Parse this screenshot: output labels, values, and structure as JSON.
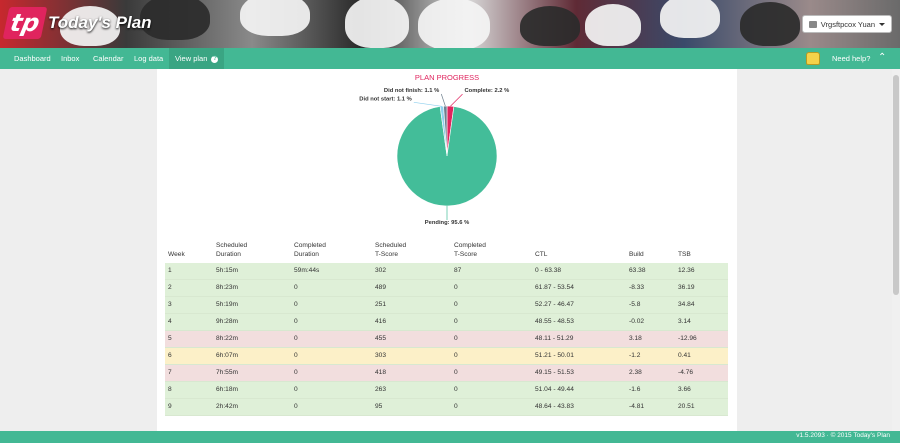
{
  "header": {
    "logo_mark": "tp",
    "logo_text": "Today's Plan",
    "user_name": "Vrgsftpcox Yuan"
  },
  "nav": {
    "items": [
      {
        "label": "Dashboard"
      },
      {
        "label": "Inbox"
      },
      {
        "label": "Calendar"
      },
      {
        "label": "Log data"
      },
      {
        "label": "View plan"
      }
    ],
    "active": "View plan",
    "help_label": "Need help?",
    "view_plan_badge": "?"
  },
  "plan_progress": {
    "title": "PLAN PROGRESS",
    "chart_data": {
      "type": "pie",
      "slices": [
        {
          "label": "Complete",
          "value": 2.2,
          "color": "#e0245e",
          "display": "Complete: 2.2 %"
        },
        {
          "label": "Pending",
          "value": 95.6,
          "color": "#43bd99",
          "display": "Pending: 95.6 %"
        },
        {
          "label": "Did not start",
          "value": 1.1,
          "color": "#8fd0ee",
          "display": "Did not start: 1.1 %"
        },
        {
          "label": "Did not finish",
          "value": 1.1,
          "color": "#6e7f8e",
          "display": "Did not finish: 1.1 %"
        }
      ]
    }
  },
  "table": {
    "headers": [
      {
        "l1": "",
        "l2": "Week"
      },
      {
        "l1": "Scheduled",
        "l2": "Duration"
      },
      {
        "l1": "Completed",
        "l2": "Duration"
      },
      {
        "l1": "Scheduled",
        "l2": "T-Score"
      },
      {
        "l1": "Completed",
        "l2": "T-Score"
      },
      {
        "l1": "",
        "l2": "CTL"
      },
      {
        "l1": "",
        "l2": "Build"
      },
      {
        "l1": "",
        "l2": "TSB"
      }
    ],
    "rows": [
      {
        "status": "green",
        "cells": [
          "1",
          "5h:15m",
          "59m:44s",
          "302",
          "87",
          "0 - 63.38",
          "63.38",
          "12.36"
        ]
      },
      {
        "status": "green",
        "cells": [
          "2",
          "8h:23m",
          "0",
          "489",
          "0",
          "61.87 - 53.54",
          "-8.33",
          "36.19"
        ]
      },
      {
        "status": "green",
        "cells": [
          "3",
          "5h:19m",
          "0",
          "251",
          "0",
          "52.27 - 46.47",
          "-5.8",
          "34.84"
        ]
      },
      {
        "status": "green",
        "cells": [
          "4",
          "9h:28m",
          "0",
          "416",
          "0",
          "48.55 - 48.53",
          "-0.02",
          "3.14"
        ]
      },
      {
        "status": "red",
        "cells": [
          "5",
          "8h:22m",
          "0",
          "455",
          "0",
          "48.11 - 51.29",
          "3.18",
          "-12.96"
        ]
      },
      {
        "status": "yellow",
        "cells": [
          "6",
          "6h:07m",
          "0",
          "303",
          "0",
          "51.21 - 50.01",
          "-1.2",
          "0.41"
        ]
      },
      {
        "status": "red",
        "cells": [
          "7",
          "7h:55m",
          "0",
          "418",
          "0",
          "49.15 - 51.53",
          "2.38",
          "-4.76"
        ]
      },
      {
        "status": "green",
        "cells": [
          "8",
          "6h:18m",
          "0",
          "263",
          "0",
          "51.04 - 49.44",
          "-1.6",
          "3.66"
        ]
      },
      {
        "status": "green",
        "cells": [
          "9",
          "2h:42m",
          "0",
          "95",
          "0",
          "48.64 - 43.83",
          "-4.81",
          "20.51"
        ]
      }
    ]
  },
  "footer": {
    "text": "v1.5.2093 · © 2015 Today's Plan"
  },
  "icons": {
    "user": "user-icon",
    "help": "jersey-icon",
    "scroll_top": "chevron-up-icon"
  }
}
